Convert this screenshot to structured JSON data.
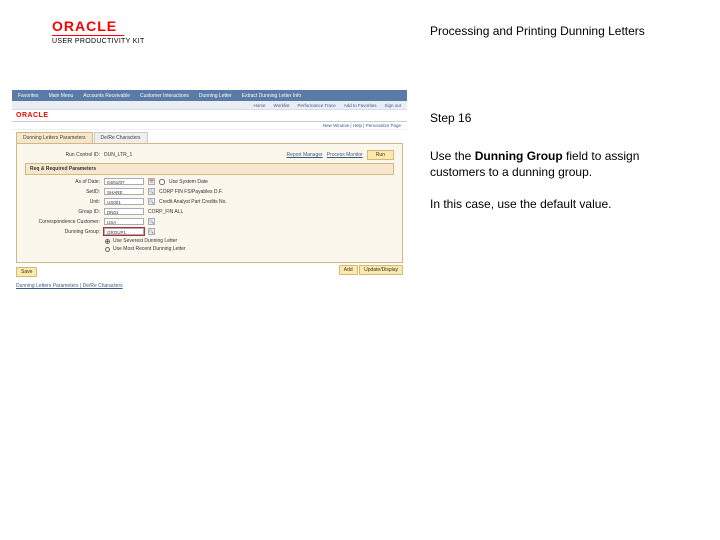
{
  "brand": {
    "name": "ORACLE",
    "product": "USER PRODUCTIVITY KIT"
  },
  "topic_title": "Processing and Printing Dunning Letters",
  "instructions": {
    "step": "Step 16",
    "body_pre": "Use the ",
    "body_bold": "Dunning Group",
    "body_post": " field to assign customers to a dunning group.",
    "note": "In this case, use the default value."
  },
  "ss": {
    "topnav": [
      "Favorites",
      "Main Menu",
      "Accounts Receivable",
      "Customer Interactions",
      "Dunning Letter",
      "Extract Dunning Letter Info"
    ],
    "subnav": [
      "Home",
      "Worklist",
      "Performance Trace",
      "Add to Favorites",
      "Sign out"
    ],
    "logo": "ORACLE",
    "breadcrumb": "New Window | Help | Personalize Page",
    "tabs": {
      "active": "Dunning Letters Parameters",
      "inactive": "De/Re Characters"
    },
    "run_control": {
      "label": "Run Control ID:",
      "value": "DUN_LTR_1",
      "links": [
        "Report Manager",
        "Process Monitor"
      ],
      "run": "Run"
    },
    "subsection": "Req & Required Parameters",
    "fields": {
      "as_of_date": {
        "label": "As of Date:",
        "value": "04/01/07",
        "extra_label": "Use System Date",
        "checked": false
      },
      "setid": {
        "label": "SetID:",
        "value": "SHARE",
        "desc": "CORP FIN FS/Payables D.F."
      },
      "unit": {
        "label": "Unit:",
        "value": "US001",
        "desc": "Credit Analyst Part Credits No."
      },
      "group": {
        "label": "Group ID:",
        "value": "DN01",
        "desc": "CORP_FIN ALL"
      },
      "corr": {
        "label": "Correspondence Customer:",
        "value": "USA",
        "desc": ""
      },
      "dunning_group": {
        "label": "Dunning Group:",
        "value": "GROUP1"
      }
    },
    "radios": {
      "opt1": "Use Severest Dunning Letter",
      "opt2": "Use Most Recent Dunning Letter"
    },
    "footer": {
      "left": "Save",
      "right1": "Add",
      "right2": "Update/Display"
    },
    "bottom_link": "Dunning Letters Parameters | De/Re Characters"
  }
}
